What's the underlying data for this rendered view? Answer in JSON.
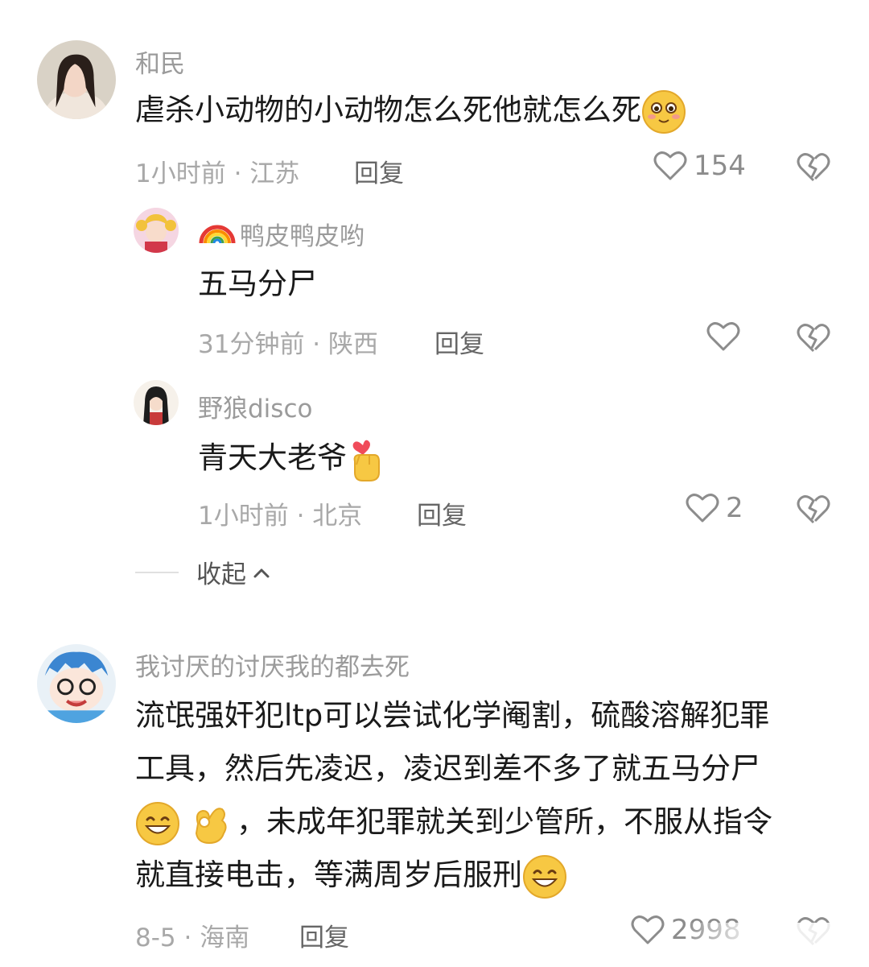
{
  "comments": [
    {
      "username": "和民",
      "text": "虐杀小动物的小动物怎么死他就怎么死",
      "emoji_after": "blushing-face-emoji",
      "time_location": "1小时前 · 江苏",
      "reply_label": "回复",
      "likes": "154",
      "replies": [
        {
          "username": "鸭皮鸭皮哟",
          "username_prefix_icon": "rainbow-emoji",
          "text": "五马分尸",
          "time_location": "31分钟前 · 陕西",
          "reply_label": "回复",
          "likes": ""
        },
        {
          "username": "野狼disco",
          "text": "青天大老爷",
          "emoji_after": "finger-heart-emoji",
          "time_location": "1小时前 · 北京",
          "reply_label": "回复",
          "likes": "2"
        }
      ],
      "collapse_label": "收起"
    },
    {
      "username": "我讨厌的讨厌我的都去死",
      "text_lines": [
        "流氓强奸犯ltp可以尝试化学阉割，硫酸溶解犯罪",
        "工具，然后先凌迟，凌迟到差不多了就五马分尸",
        "，未成年犯罪就关到少管所，不服从指令",
        "就直接电击，等满周岁后服刑"
      ],
      "time_location": "8-5 · 海南",
      "reply_label": "回复",
      "likes": "2998"
    }
  ],
  "colors": {
    "meta_gray": "#a8a8a8",
    "username_gray": "#9b9b9b",
    "text": "#1a1a1a",
    "emoji_yellow": "#f7c843"
  }
}
